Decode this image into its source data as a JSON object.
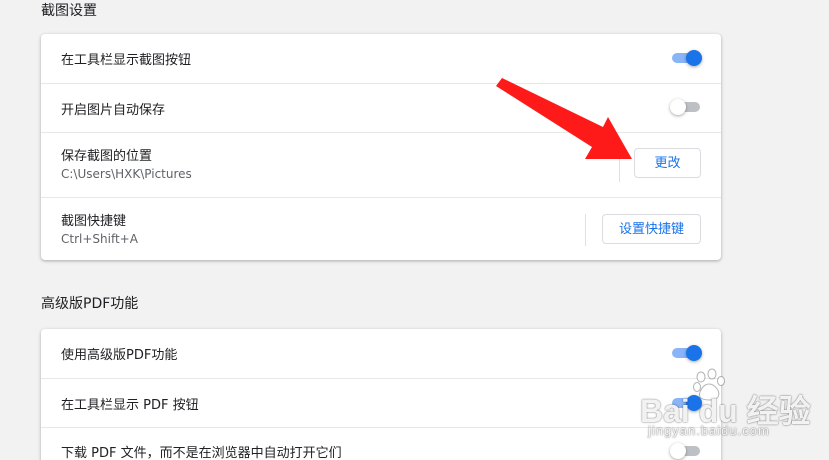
{
  "colors": {
    "background": "#f2f2f2",
    "card": "#ffffff",
    "accent": "#1a73e8",
    "toggle_on_track": "#8ab4f8",
    "toggle_off_track": "#bdc1c6",
    "annotation_arrow": "#ff1a1a"
  },
  "sections": [
    {
      "title": "截图设置",
      "rows": [
        {
          "label": "在工具栏显示截图按钮",
          "control": "toggle",
          "on": true
        },
        {
          "label": "开启图片自动保存",
          "control": "toggle",
          "on": false
        },
        {
          "label": "保存截图的位置",
          "sub": "C:\\Users\\HXK\\Pictures",
          "control": "button",
          "button_label": "更改"
        },
        {
          "label": "截图快捷键",
          "sub": "Ctrl+Shift+A",
          "control": "button",
          "button_label": "设置快捷键"
        }
      ]
    },
    {
      "title": "高级版PDF功能",
      "rows": [
        {
          "label": "使用高级版PDF功能",
          "control": "toggle",
          "on": true
        },
        {
          "label": "在工具栏显示 PDF 按钮",
          "control": "toggle",
          "on": true
        },
        {
          "label": "下载 PDF 文件，而不是在浏览器中自动打开它们",
          "control": "toggle",
          "on": false
        }
      ]
    }
  ],
  "annotation": {
    "icon": "red-arrow-icon"
  },
  "watermark": {
    "main": "Bai du 经验",
    "sub": "jingyan.baidu.com",
    "icon": "baidu-paw-icon"
  }
}
